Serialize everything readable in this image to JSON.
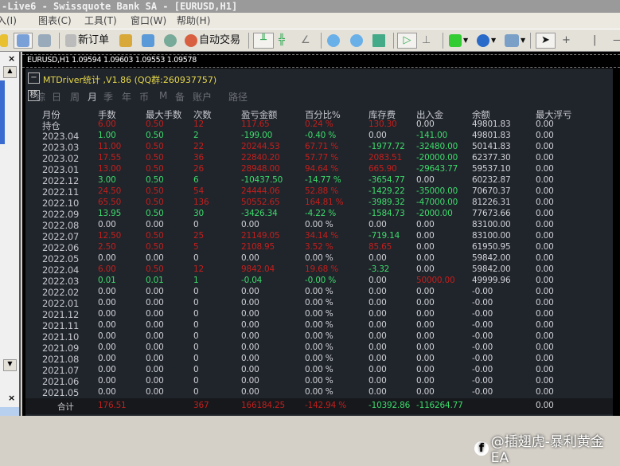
{
  "window": {
    "title": "-Live6 - Swissquote Bank SA - [EURUSD,H1]"
  },
  "menu": [
    "入(I)",
    "图表(C)",
    "工具(T)",
    "窗口(W)",
    "帮助(H)"
  ],
  "toolbar": {
    "new_order": "新订单",
    "auto_trading": "自动交易"
  },
  "chart": {
    "info": "EURUSD,H1  1.09594 1.09603 1.09553 1.09578",
    "side_label": "#3"
  },
  "panel": {
    "title": "MTDriver统计 ,V1.86 (QQ群:260937757)",
    "collapse_label": "−",
    "move_label": "移",
    "tabs": [
      "综",
      "日",
      "周",
      "月",
      "季",
      "年",
      "币",
      "M",
      "备",
      "账户",
      "路径"
    ],
    "active_tab": "月",
    "headers": [
      "月份",
      "手数",
      "最大手数",
      "次数",
      "盈亏金额",
      "百分比%",
      "库存费",
      "出入金",
      "余额",
      "最大浮亏"
    ],
    "rows": [
      [
        "持仓",
        "6.00",
        "0.50",
        "12",
        "117.65",
        "0.24 %",
        "130.30",
        "0.00",
        "49801.83",
        "0.00"
      ],
      [
        "2023.04",
        "1.00",
        "0.50",
        "2",
        "-199.00",
        "-0.40 %",
        "0.00",
        "-141.00",
        "49801.83",
        "0.00"
      ],
      [
        "2023.03",
        "11.00",
        "0.50",
        "22",
        "20244.53",
        "67.71 %",
        "-1977.72",
        "-32480.00",
        "50141.83",
        "0.00"
      ],
      [
        "2023.02",
        "17.55",
        "0.50",
        "36",
        "22840.20",
        "57.77 %",
        "2083.51",
        "-20000.00",
        "62377.30",
        "0.00"
      ],
      [
        "2023.01",
        "13.00",
        "0.50",
        "26",
        "28948.00",
        "94.64 %",
        "665.90",
        "-29643.77",
        "59537.10",
        "0.00"
      ],
      [
        "2022.12",
        "3.00",
        "0.50",
        "6",
        "-10437.50",
        "-14.77 %",
        "-3654.77",
        "0.00",
        "60232.87",
        "0.00"
      ],
      [
        "2022.11",
        "24.50",
        "0.50",
        "54",
        "24444.06",
        "52.88 %",
        "-1429.22",
        "-35000.00",
        "70670.37",
        "0.00"
      ],
      [
        "2022.10",
        "65.50",
        "0.50",
        "136",
        "50552.65",
        "164.81 %",
        "-3989.32",
        "-47000.00",
        "81226.31",
        "0.00"
      ],
      [
        "2022.09",
        "13.95",
        "0.50",
        "30",
        "-3426.34",
        "-4.22 %",
        "-1584.73",
        "-2000.00",
        "77673.66",
        "0.00"
      ],
      [
        "2022.08",
        "0.00",
        "0.00",
        "0",
        "0.00",
        "0.00 %",
        "0.00",
        "0.00",
        "83100.00",
        "0.00"
      ],
      [
        "2022.07",
        "12.50",
        "0.50",
        "25",
        "21149.05",
        "34.14 %",
        "-719.14",
        "0.00",
        "83100.00",
        "0.00"
      ],
      [
        "2022.06",
        "2.50",
        "0.50",
        "5",
        "2108.95",
        "3.52 %",
        "85.65",
        "0.00",
        "61950.95",
        "0.00"
      ],
      [
        "2022.05",
        "0.00",
        "0.00",
        "0",
        "0.00",
        "0.00 %",
        "0.00",
        "0.00",
        "59842.00",
        "0.00"
      ],
      [
        "2022.04",
        "6.00",
        "0.50",
        "12",
        "9842.04",
        "19.68 %",
        "-3.32",
        "0.00",
        "59842.00",
        "0.00"
      ],
      [
        "2022.03",
        "0.01",
        "0.01",
        "1",
        "-0.04",
        "-0.00 %",
        "0.00",
        "50000.00",
        "49999.96",
        "0.00"
      ],
      [
        "2022.02",
        "0.00",
        "0.00",
        "0",
        "0.00",
        "0.00 %",
        "0.00",
        "0.00",
        "-0.00",
        "0.00"
      ],
      [
        "2022.01",
        "0.00",
        "0.00",
        "0",
        "0.00",
        "0.00 %",
        "0.00",
        "0.00",
        "-0.00",
        "0.00"
      ],
      [
        "2021.12",
        "0.00",
        "0.00",
        "0",
        "0.00",
        "0.00 %",
        "0.00",
        "0.00",
        "-0.00",
        "0.00"
      ],
      [
        "2021.11",
        "0.00",
        "0.00",
        "0",
        "0.00",
        "0.00 %",
        "0.00",
        "0.00",
        "-0.00",
        "0.00"
      ],
      [
        "2021.10",
        "0.00",
        "0.00",
        "0",
        "0.00",
        "0.00 %",
        "0.00",
        "0.00",
        "-0.00",
        "0.00"
      ],
      [
        "2021.09",
        "0.00",
        "0.00",
        "0",
        "0.00",
        "0.00 %",
        "0.00",
        "0.00",
        "-0.00",
        "0.00"
      ],
      [
        "2021.08",
        "0.00",
        "0.00",
        "0",
        "0.00",
        "0.00 %",
        "0.00",
        "0.00",
        "-0.00",
        "0.00"
      ],
      [
        "2021.07",
        "0.00",
        "0.00",
        "0",
        "0.00",
        "0.00 %",
        "0.00",
        "0.00",
        "-0.00",
        "0.00"
      ],
      [
        "2021.06",
        "0.00",
        "0.00",
        "0",
        "0.00",
        "0.00 %",
        "0.00",
        "0.00",
        "-0.00",
        "0.00"
      ],
      [
        "2021.05",
        "0.00",
        "0.00",
        "0",
        "0.00",
        "0.00 %",
        "0.00",
        "0.00",
        "-0.00",
        "0.00"
      ]
    ],
    "totals": [
      "合计",
      "176.51",
      "",
      "367",
      "166184.25",
      "-142.94 %",
      "-10392.86",
      "-116264.77",
      "",
      "0.00"
    ]
  },
  "colors": {
    "profit": "#c41f1c",
    "loss": "#3ddc6b",
    "neutral": "#d0d2d6",
    "title": "#e6d84a"
  },
  "watermark": "@插翅虎-暴利黄金EA"
}
